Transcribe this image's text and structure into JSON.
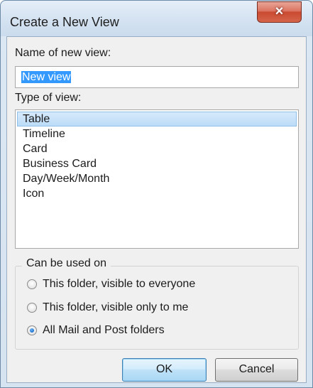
{
  "window": {
    "title": "Create a New View",
    "close_glyph": "×"
  },
  "name_section": {
    "label": "Name of new view:",
    "value": "New view"
  },
  "type_section": {
    "label": "Type of view:",
    "items": [
      "Table",
      "Timeline",
      "Card",
      "Business Card",
      "Day/Week/Month",
      "Icon"
    ],
    "selected": "Table"
  },
  "usage": {
    "legend": "Can be used on",
    "options": [
      {
        "label": "This folder, visible to everyone",
        "checked": false
      },
      {
        "label": "This folder, visible only to me",
        "checked": false
      },
      {
        "label": "All Mail and Post folders",
        "checked": true
      }
    ]
  },
  "buttons": {
    "ok": "OK",
    "cancel": "Cancel"
  },
  "colors": {
    "selection": "#3399ff",
    "close": "#c94a31",
    "ok_border": "#3c7fb1"
  },
  "icons": {
    "close": "close-icon"
  }
}
